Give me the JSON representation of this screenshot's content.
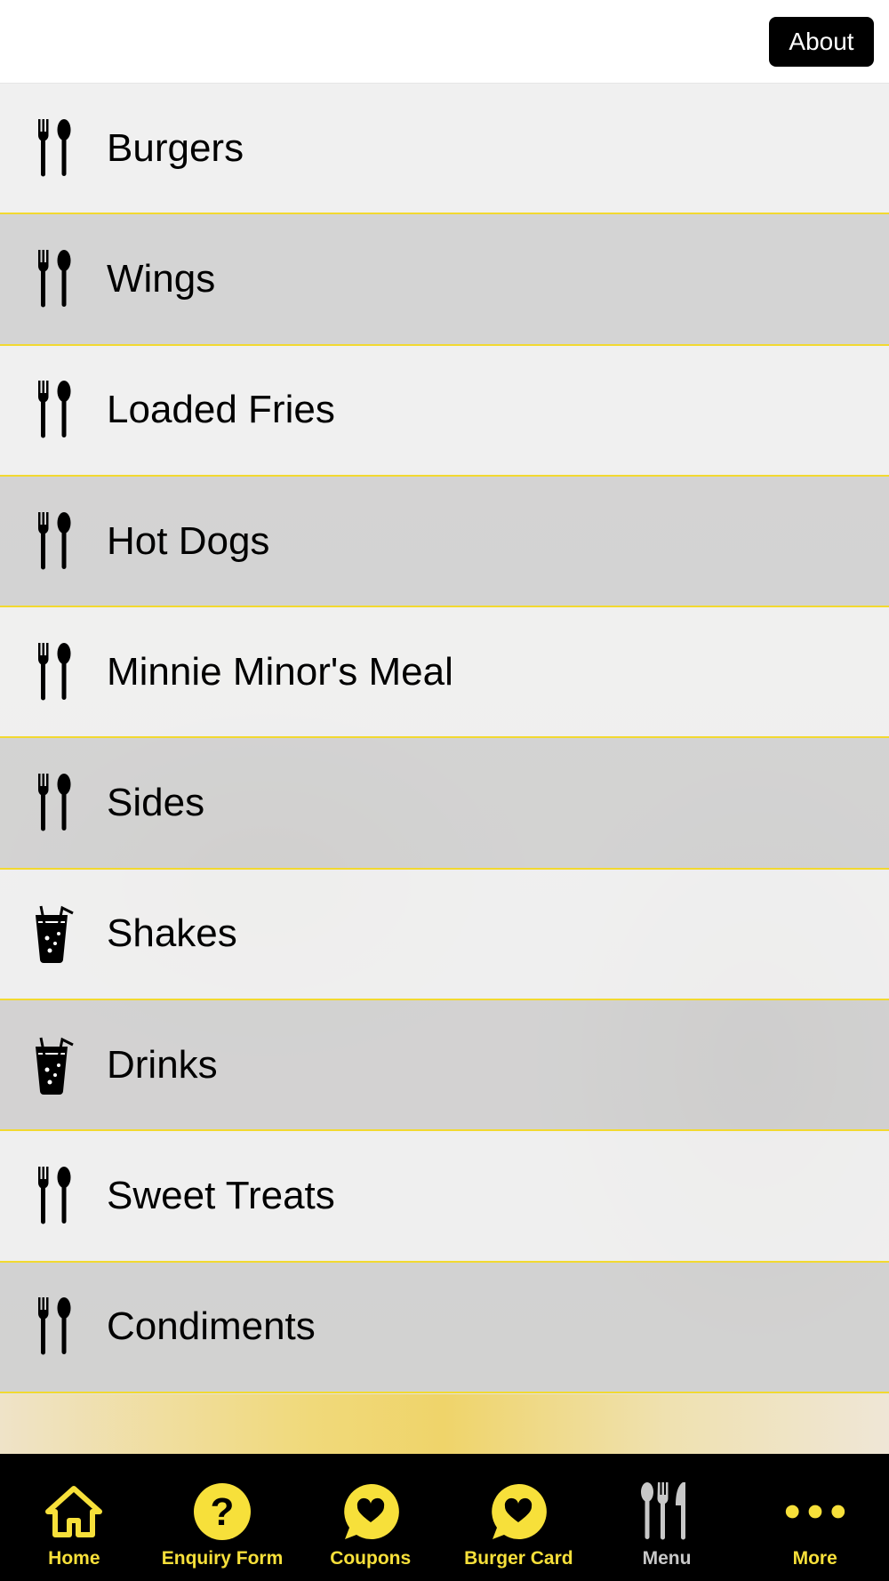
{
  "header": {
    "about_label": "About"
  },
  "menu": {
    "items": [
      {
        "label": "Burgers",
        "icon": "cutlery-icon"
      },
      {
        "label": "Wings",
        "icon": "cutlery-icon"
      },
      {
        "label": "Loaded Fries",
        "icon": "cutlery-icon"
      },
      {
        "label": "Hot Dogs",
        "icon": "cutlery-icon"
      },
      {
        "label": "Minnie Minor's Meal",
        "icon": "cutlery-icon"
      },
      {
        "label": "Sides",
        "icon": "cutlery-icon"
      },
      {
        "label": "Shakes",
        "icon": "drink-icon"
      },
      {
        "label": "Drinks",
        "icon": "drink-icon"
      },
      {
        "label": "Sweet Treats",
        "icon": "cutlery-icon"
      },
      {
        "label": "Condiments",
        "icon": "cutlery-icon"
      }
    ]
  },
  "tabbar": {
    "active": "Menu",
    "tabs": [
      {
        "label": "Home",
        "icon": "home-icon"
      },
      {
        "label": "Enquiry Form",
        "icon": "question-icon"
      },
      {
        "label": "Coupons",
        "icon": "heart-bubble-icon"
      },
      {
        "label": "Burger Card",
        "icon": "heart-bubble-icon"
      },
      {
        "label": "Menu",
        "icon": "cutlery-icon"
      },
      {
        "label": "More",
        "icon": "more-dots-icon"
      }
    ]
  },
  "colors": {
    "accent": "#f7e03a",
    "separator": "#f2d930",
    "tabbar_bg": "#000000",
    "active_tab": "#c8c8c8"
  }
}
